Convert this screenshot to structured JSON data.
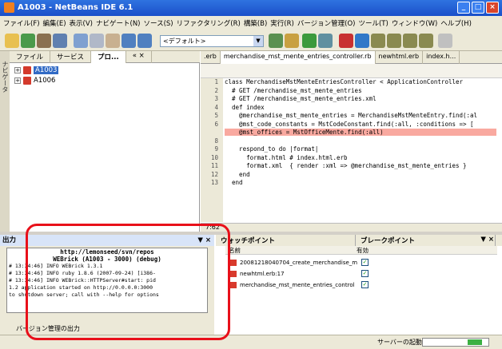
{
  "window": {
    "title": "A1003 - NetBeans IDE 6.1",
    "buttons": [
      "_",
      "□",
      "×"
    ]
  },
  "menubar": [
    "ファイル(F)",
    "編集(E)",
    "表示(V)",
    "ナビゲート(N)",
    "ソース(S)",
    "リファクタリング(R)",
    "構築(B)",
    "実行(R)",
    "バージョン管理(O)",
    "ツール(T)",
    "ウィンドウ(W)",
    "ヘルプ(H)"
  ],
  "toolbar": {
    "config": "<デフォルト>",
    "config_arrow": "▼"
  },
  "sidestrip": {
    "label": "ナビゲータ"
  },
  "left_panel": {
    "tabs": [
      "ファイル",
      "サービス",
      "プロ..."
    ],
    "close": "«  ×",
    "tree": [
      {
        "label": "A1003",
        "selected": true
      },
      {
        "label": "A1006",
        "selected": false
      }
    ]
  },
  "editor": {
    "tabs": [
      ".erb",
      "merchandise_mst_mente_entries_controller.rb",
      "newhtml.erb",
      "index.h..."
    ],
    "code": [
      {
        "n": "1",
        "text": "class MerchandiseMstMenteEntriesController < ApplicationController"
      },
      {
        "n": "2",
        "text": "  # GET /merchandise_mst_mente_entries"
      },
      {
        "n": "3",
        "text": "  # GET /merchandise_mst_mente_entries.xml"
      },
      {
        "n": "4",
        "text": "  def index"
      },
      {
        "n": "5",
        "text": "    @merchandise_mst_mente_entries = MerchandiseMstMenteEntry.find(:al"
      },
      {
        "n": "6",
        "text": "    @mst_code_constants = MstCodeConstant.find(:all, :conditions => ["
      },
      {
        "n": "",
        "text": "    @mst_offices = MstOfficeMente.find(:all)"
      },
      {
        "n": "8",
        "text": ""
      },
      {
        "n": "9",
        "text": "    respond_to do |format|"
      },
      {
        "n": "10",
        "text": "      format.html # index.html.erb"
      },
      {
        "n": "11",
        "text": "      format.xml  { render :xml => @merchandise_mst_mente_entries }"
      },
      {
        "n": "12",
        "text": "    end"
      },
      {
        "n": "13",
        "text": "  end"
      }
    ],
    "position": "7:62"
  },
  "output": {
    "title": "出力",
    "controls": "▼ ×",
    "head_url": "http://lemonseed/svn/repos",
    "head": "WEBrick (A1003 - 3000) (debug)",
    "lines": [
      "# 13:34:46] INFO  WEBrick 1.3.1",
      "# 13:34:46] INFO  ruby 1.8.6 (2007-09-24) [i386-",
      "# 13:34:46] INFO  WEBrick::HTTPServer#start: pid",
      "1.2 application started on http://0.0.0.0:3000",
      "to shutdown server; call with --help for options"
    ],
    "footer": "バージョン管理の出力"
  },
  "watch": {
    "tabs": [
      "ウォッチポイント",
      "ブレークポイント"
    ],
    "controls": "▼ ×",
    "columns": [
      "名前",
      "有効"
    ],
    "rows": [
      "20081218040704_create_merchandise_m",
      "newhtml.erb:17",
      "merchandise_mst_mente_entries_control"
    ]
  },
  "status": {
    "label": "サーバーの起動",
    "progress": 0.7
  }
}
